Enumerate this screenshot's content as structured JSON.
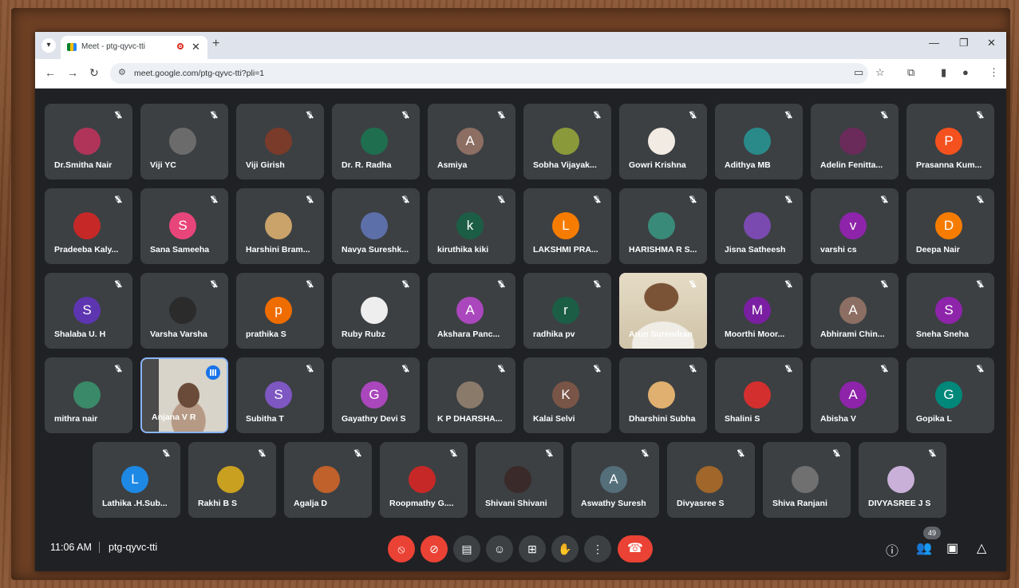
{
  "browser": {
    "tab_title": "Meet - ptg-qyvc-tti",
    "url": "meet.google.com/ptg-qyvc-tti?pli=1",
    "new_tab": "+",
    "close": "✕"
  },
  "participants": [
    {
      "name": "Dr.Smitha Nair",
      "initial": "",
      "color": "#b0345a"
    },
    {
      "name": "Viji YC",
      "initial": "",
      "color": "#6b6b6b"
    },
    {
      "name": "Viji Girish",
      "initial": "",
      "color": "#7a3b2a"
    },
    {
      "name": "Dr. R. Radha",
      "initial": "",
      "color": "#1f6e4f"
    },
    {
      "name": "Asmiya",
      "initial": "A",
      "color": "#8d6e63"
    },
    {
      "name": "Sobha Vijayak...",
      "initial": "",
      "color": "#8a9a3a"
    },
    {
      "name": "Gowri Krishna",
      "initial": "",
      "color": "#f1ebe4"
    },
    {
      "name": "Adithya MB",
      "initial": "",
      "color": "#2a8a8a"
    },
    {
      "name": "Adelin Fenitta...",
      "initial": "",
      "color": "#6a2a5a"
    },
    {
      "name": "Prasanna Kum...",
      "initial": "P",
      "color": "#f4511e"
    },
    {
      "name": "Pradeeba Kaly...",
      "initial": "",
      "color": "#c62828"
    },
    {
      "name": "Sana Sameeha",
      "initial": "S",
      "color": "#e8457a"
    },
    {
      "name": "Harshini Bram...",
      "initial": "",
      "color": "#c9a36a"
    },
    {
      "name": "Navya Sureshk...",
      "initial": "",
      "color": "#5d6fa8"
    },
    {
      "name": "kiruthika kiki",
      "initial": "k",
      "color": "#1b5e45"
    },
    {
      "name": "LAKSHMI PRA...",
      "initial": "L",
      "color": "#f57c00"
    },
    {
      "name": "HARISHMA R S...",
      "initial": "",
      "color": "#3a8a7a"
    },
    {
      "name": "Jisna Satheesh",
      "initial": "",
      "color": "#7a4ab0"
    },
    {
      "name": "varshi cs",
      "initial": "v",
      "color": "#8e24aa"
    },
    {
      "name": "Deepa Nair",
      "initial": "D",
      "color": "#f57c00"
    },
    {
      "name": "Shalaba U. H",
      "initial": "S",
      "color": "#5e35b1"
    },
    {
      "name": "Varsha Varsha",
      "initial": "",
      "color": "#2b2b2b"
    },
    {
      "name": "prathika S",
      "initial": "p",
      "color": "#ef6c00"
    },
    {
      "name": "Ruby Rubz",
      "initial": "",
      "color": "#eeeeee"
    },
    {
      "name": "Akshara Panc...",
      "initial": "A",
      "color": "#ab47bc"
    },
    {
      "name": "radhika pv",
      "initial": "r",
      "color": "#1b5e45"
    },
    {
      "name": "Arun Surendran",
      "initial": "",
      "color": "",
      "video": true
    },
    {
      "name": "Moorthi Moor...",
      "initial": "M",
      "color": "#7b1fa2"
    },
    {
      "name": "Abhirami Chin...",
      "initial": "A",
      "color": "#8d6e63"
    },
    {
      "name": "Sneha Sneha",
      "initial": "S",
      "color": "#8e24aa"
    },
    {
      "name": "mithra nair",
      "initial": "",
      "color": "#3a8a6a"
    },
    {
      "name": "Anjana V R",
      "initial": "",
      "color": "",
      "video": true,
      "speaking": true
    },
    {
      "name": "Subitha T",
      "initial": "S",
      "color": "#7e57c2"
    },
    {
      "name": "Gayathry Devi S",
      "initial": "G",
      "color": "#ab47bc"
    },
    {
      "name": "K P DHARSHA...",
      "initial": "",
      "color": "#8a7a6a"
    },
    {
      "name": "Kalai Selvi",
      "initial": "K",
      "color": "#795548"
    },
    {
      "name": "Dharshini Subha",
      "initial": "",
      "color": "#e0b070"
    },
    {
      "name": "Shalini S",
      "initial": "",
      "color": "#d32f2f"
    },
    {
      "name": "Abisha V",
      "initial": "A",
      "color": "#8e24aa"
    },
    {
      "name": "Gopika L",
      "initial": "G",
      "color": "#00897b"
    },
    {
      "name": "Lathika .H.Sub...",
      "initial": "L",
      "color": "#1e88e5"
    },
    {
      "name": "Rakhi B S",
      "initial": "",
      "color": "#c9a020"
    },
    {
      "name": "Agalja D",
      "initial": "",
      "color": "#c0602a"
    },
    {
      "name": "Roopmathy G....",
      "initial": "",
      "color": "#c62828"
    },
    {
      "name": "Shivani Shivani",
      "initial": "",
      "color": "#3a2a2a"
    },
    {
      "name": "Aswathy Suresh",
      "initial": "A",
      "color": "#546e7a"
    },
    {
      "name": "Divyasree S",
      "initial": "",
      "color": "#a0662a"
    },
    {
      "name": "Shiva Ranjani",
      "initial": "",
      "color": "#707070"
    },
    {
      "name": "DIVYASREE J S",
      "initial": "",
      "color": "#c9b0d8"
    }
  ],
  "bottom_bar": {
    "time": "11:06 AM",
    "meeting_code": "ptg-qyvc-tti",
    "participant_count": "49"
  }
}
